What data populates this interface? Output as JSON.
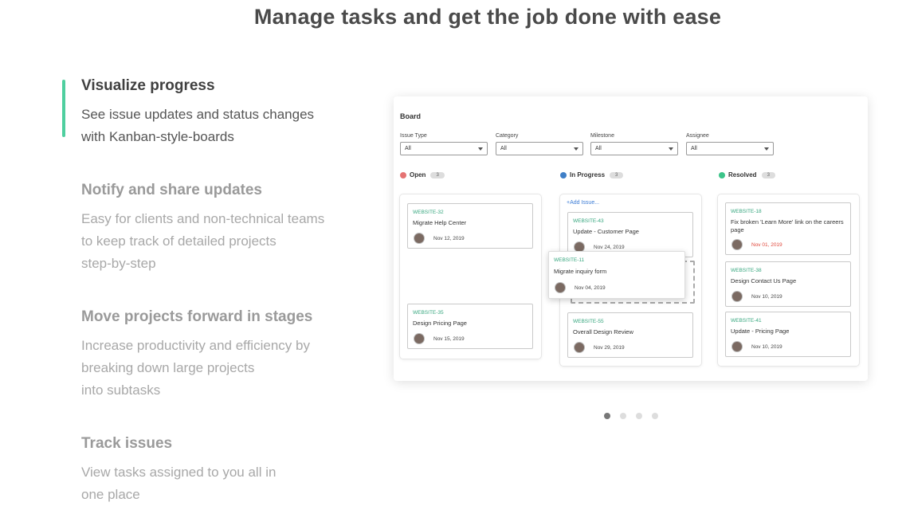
{
  "headline": "Manage tasks and get the job done with ease",
  "features": [
    {
      "title": "Visualize progress",
      "text": "See issue updates and status changes\nwith Kanban-style-boards",
      "active": true
    },
    {
      "title": "Notify and share updates",
      "text": "Easy for clients and non-technical teams\nto keep track of detailed projects\nstep-by-step",
      "active": false
    },
    {
      "title": "Move projects forward in stages",
      "text": "Increase productivity and efficiency by\nbreaking down large projects\ninto subtasks",
      "active": false
    },
    {
      "title": "Track issues",
      "text": "View tasks assigned to you all in\none place",
      "active": false
    }
  ],
  "accent_color": "#4fcf9f",
  "board": {
    "title": "Board",
    "filters": [
      {
        "label": "Issue Type",
        "value": "All"
      },
      {
        "label": "Category",
        "value": "All"
      },
      {
        "label": "Milestone",
        "value": "All"
      },
      {
        "label": "Assignee",
        "value": "All"
      }
    ],
    "columns": [
      {
        "name": "Open",
        "count": "3",
        "color": "#e57373"
      },
      {
        "name": "In Progress",
        "count": "3",
        "color": "#3f7fc7"
      },
      {
        "name": "Resolved",
        "count": "3",
        "color": "#3cc489"
      }
    ],
    "add_issue": "+Add Issue...",
    "cards": {
      "open": [
        {
          "id": "WEBSITE-32",
          "title": "Migrate Help Center",
          "date": "Nov 12, 2019"
        },
        {
          "id": "WEBSITE-35",
          "title": "Design Pricing Page",
          "date": "Nov 15, 2019"
        }
      ],
      "in_progress": [
        {
          "id": "WEBSITE-43",
          "title": "Update - Customer Page",
          "date": "Nov 24, 2019"
        },
        {
          "id": "WEBSITE-55",
          "title": "Overall Design Review",
          "date": "Nov 29, 2019"
        }
      ],
      "dragging": {
        "id": "WEBSITE-11",
        "title": "Migrate inquiry form",
        "date": "Nov 04, 2019"
      },
      "resolved": [
        {
          "id": "WEBSITE-18",
          "title": "Fix broken 'Learn More' link on the careers page",
          "date": "Nov 01, 2019"
        },
        {
          "id": "WEBSITE-38",
          "title": "Design Contact Us Page",
          "date": "Nov 10, 2019"
        },
        {
          "id": "WEBSITE-41",
          "title": "Update - Pricing Page",
          "date": "Nov 10, 2019"
        }
      ]
    }
  },
  "carousel": {
    "count": 4,
    "active": 1
  }
}
